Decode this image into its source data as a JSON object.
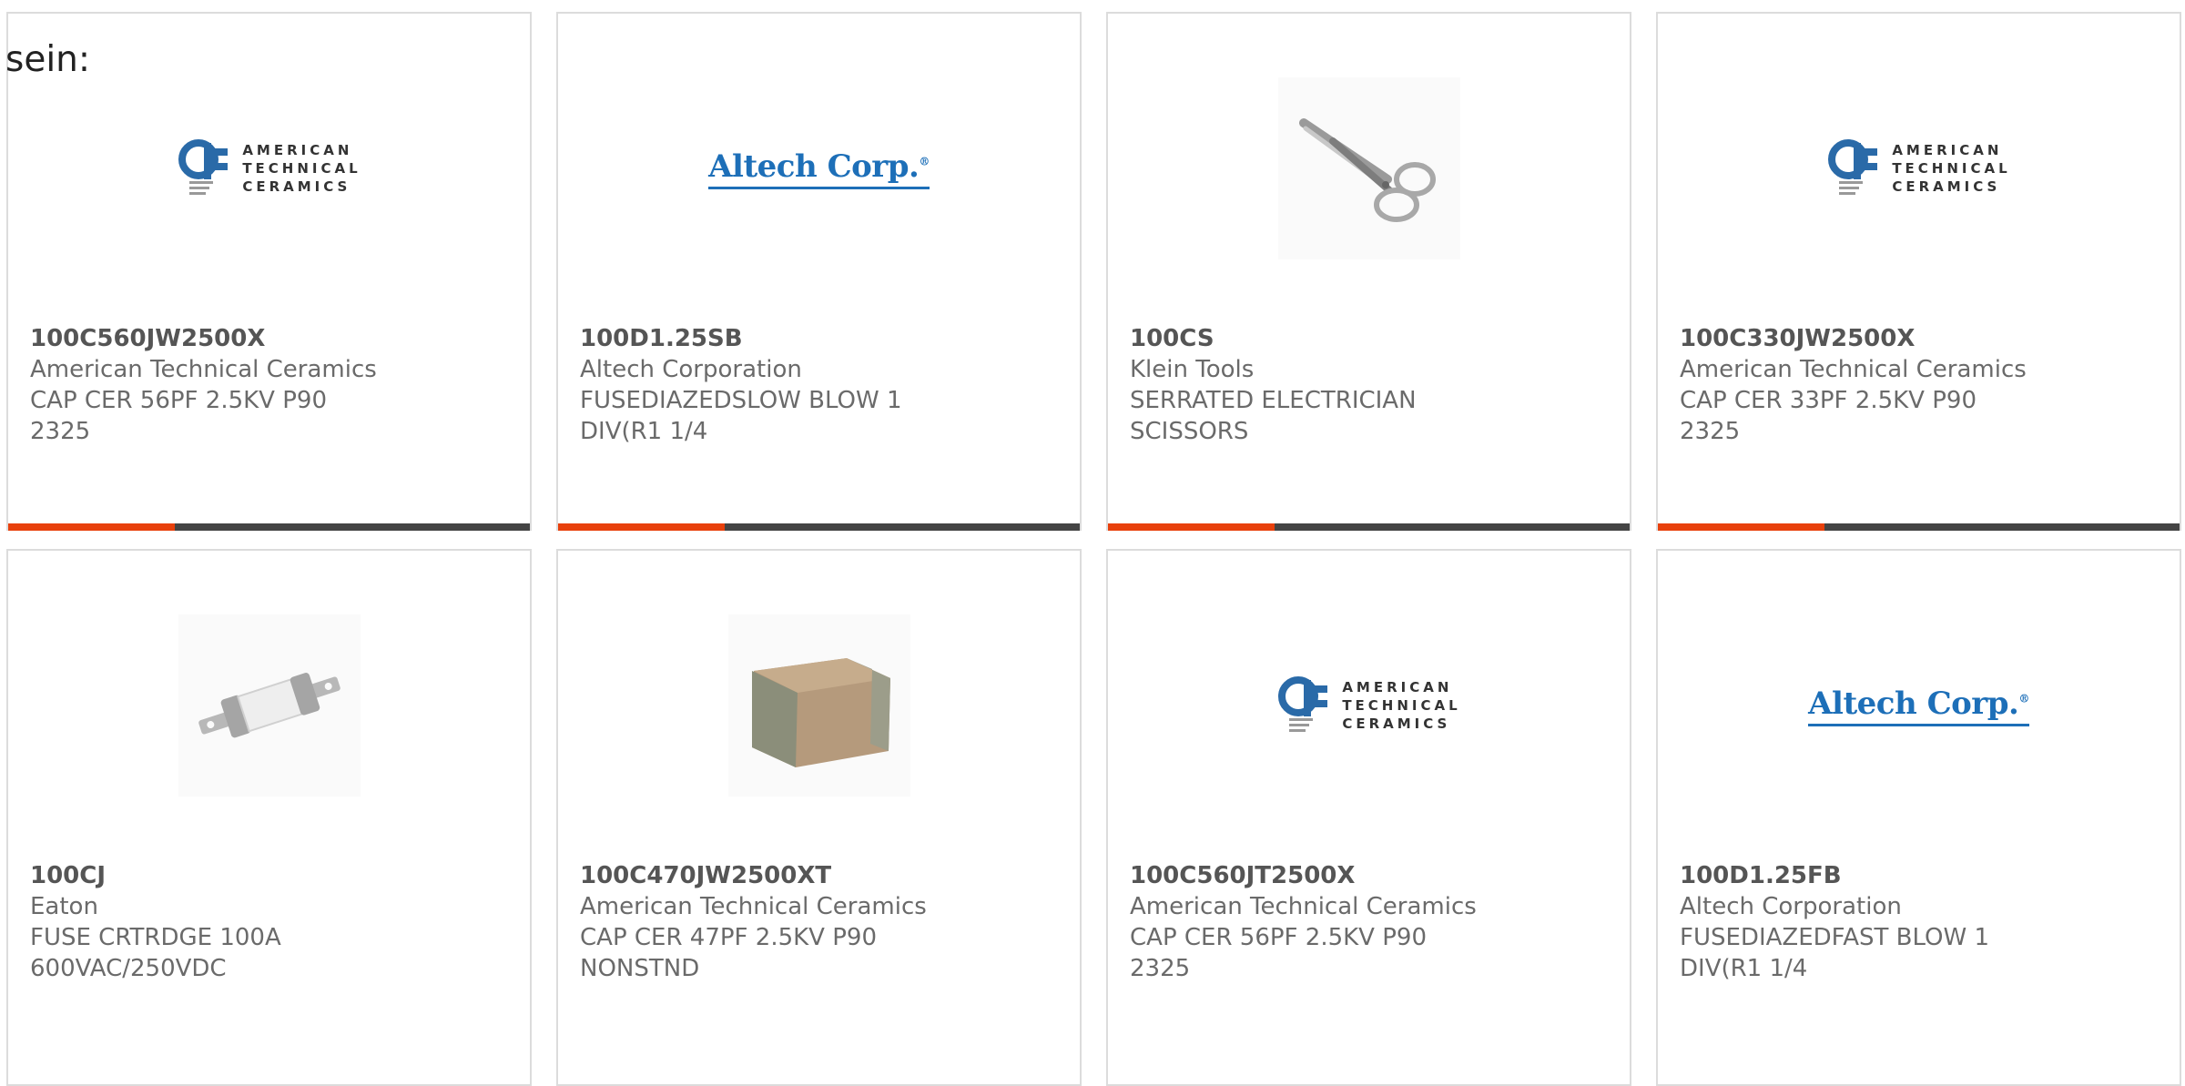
{
  "intro": "sein:",
  "products": [
    {
      "part": "100C560JW2500X",
      "manufacturer": "American Technical Ceramics",
      "description": "CAP CER 56PF 2.5KV P90 2325",
      "image": "atc-logo"
    },
    {
      "part": "100D1.25SB",
      "manufacturer": "Altech Corporation",
      "description": "FUSEDIAZEDSLOW BLOW 1 DIV(R1 1/4",
      "image": "altech-logo"
    },
    {
      "part": "100CS",
      "manufacturer": "Klein Tools",
      "description": "SERRATED ELECTRICIAN SCISSORS",
      "image": "scissors-photo"
    },
    {
      "part": "100C330JW2500X",
      "manufacturer": "American Technical Ceramics",
      "description": "CAP CER 33PF 2.5KV P90 2325",
      "image": "atc-logo"
    },
    {
      "part": "100CJ",
      "manufacturer": "Eaton",
      "description": "FUSE CRTRDGE 100A 600VAC/250VDC",
      "image": "fuse-photo"
    },
    {
      "part": "100C470JW2500XT",
      "manufacturer": "American Technical Ceramics",
      "description": "CAP CER 47PF 2.5KV P90 NONSTND",
      "image": "capacitor-photo"
    },
    {
      "part": "100C560JT2500X",
      "manufacturer": "American Technical Ceramics",
      "description": "CAP CER 56PF 2.5KV P90 2325",
      "image": "atc-logo"
    },
    {
      "part": "100D1.25FB",
      "manufacturer": "Altech Corporation",
      "description": "FUSEDIAZEDFAST BLOW 1 DIV(R1 1/4",
      "image": "altech-logo"
    }
  ],
  "logos": {
    "atc_lines": [
      "AMERICAN",
      "TECHNICAL",
      "CERAMICS"
    ],
    "altech": "Altech Corp.",
    "altech_mark": "®"
  },
  "colors": {
    "accent": "#e8400c",
    "bar": "#444444",
    "altech_blue": "#1d6fb8",
    "atc_blue": "#2a6aa8"
  }
}
